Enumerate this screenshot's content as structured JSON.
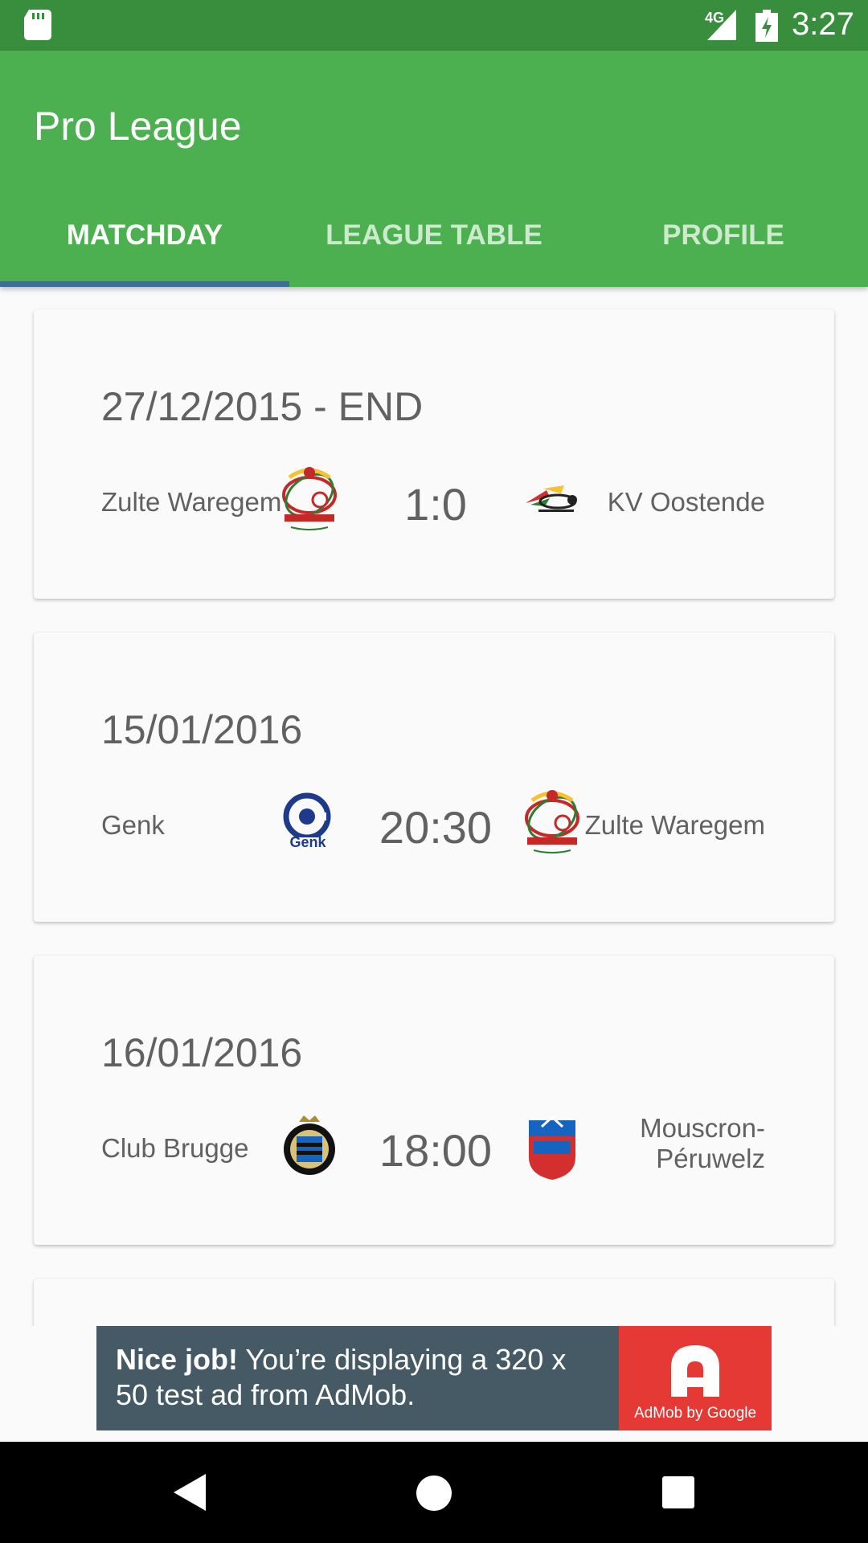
{
  "status_bar": {
    "network": "4G",
    "time": "3:27"
  },
  "app_bar": {
    "title": "Pro League",
    "tabs": [
      {
        "label": "MATCHDAY",
        "active": true
      },
      {
        "label": "LEAGUE TABLE",
        "active": false
      },
      {
        "label": "PROFILE",
        "active": false
      }
    ]
  },
  "matches": [
    {
      "date": "27/12/2015 - END",
      "home": "Zulte Waregem",
      "score": "1:0",
      "away": "KV Oostende",
      "home_logo": "zulte-waregem-logo",
      "away_logo": "kv-oostende-logo"
    },
    {
      "date": "15/01/2016",
      "home": "Genk",
      "score": "20:30",
      "away": "Zulte Waregem",
      "home_logo": "genk-logo",
      "away_logo": "zulte-waregem-logo"
    },
    {
      "date": "16/01/2016",
      "home": "Club Brugge",
      "score": "18:00",
      "away_line1": "Mouscron-",
      "away_line2": "Péruwelz",
      "home_logo": "club-brugge-logo",
      "away_logo": "mouscron-peruwelz-logo"
    }
  ],
  "ad": {
    "headline": "Nice job!",
    "body": " You’re displaying a 320 x 50 test ad from AdMob.",
    "brand": "AdMob by Google"
  },
  "colors": {
    "primary": "#4caf50",
    "primary_dark": "#388e3c",
    "indicator": "#3f6d93",
    "ad_bg": "#455a64",
    "ad_accent": "#e53935"
  },
  "nav_bar": {
    "icons": [
      "back-icon",
      "home-icon",
      "recents-icon"
    ]
  }
}
